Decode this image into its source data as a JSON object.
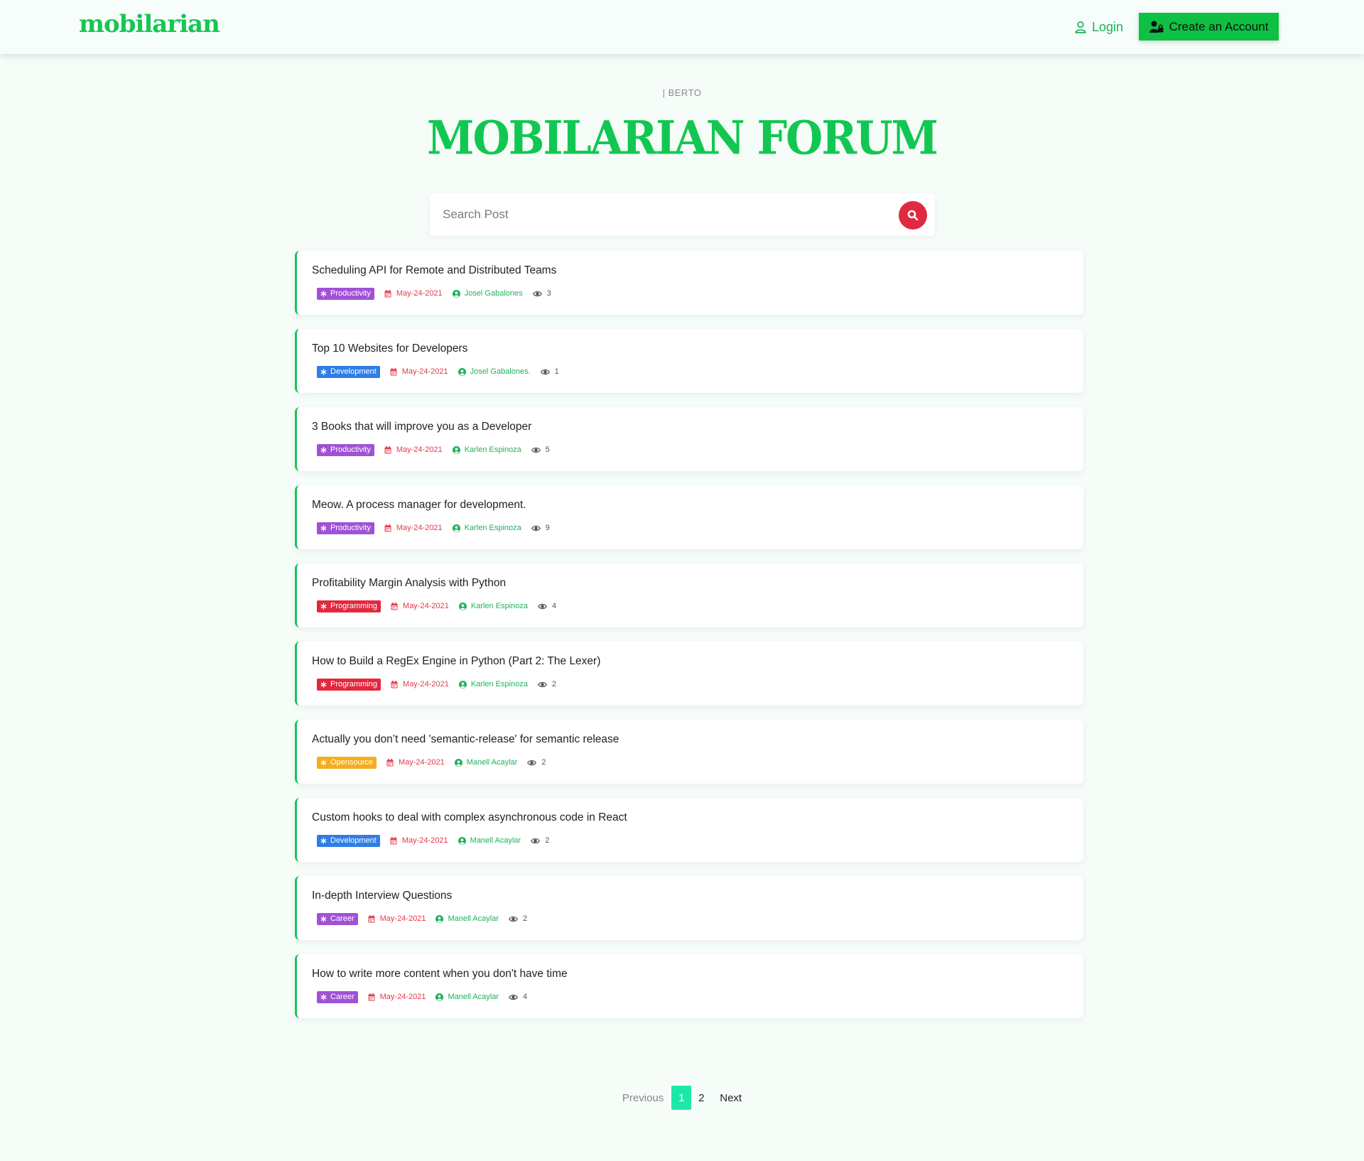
{
  "navbar": {
    "brand": "mobilarian",
    "login_label": "Login",
    "create_account_label": "Create an Account",
    "accent_color": "#17c653"
  },
  "hero": {
    "subtitle": "| BERTO",
    "title": "MOBILARIAN FORUM"
  },
  "search": {
    "placeholder": "Search Post",
    "value": "",
    "button_icon": "search-icon"
  },
  "posts": [
    {
      "title": "Scheduling API for Remote and Distributed Teams",
      "category": "Productivity",
      "category_color": "#a052d6",
      "date": "May-24-2021",
      "author": "Josel Gabalones",
      "views": "3"
    },
    {
      "title": "Top 10 Websites for Developers",
      "category": "Development",
      "category_color": "#2f7de6",
      "date": "May-24-2021",
      "author": "Josel Gabalones.",
      "views": "1"
    },
    {
      "title": "3 Books that will improve you as a Developer",
      "category": "Productivity",
      "category_color": "#a052d6",
      "date": "May-24-2021",
      "author": "Karlen Espinoza",
      "views": "5"
    },
    {
      "title": "Meow. A process manager for development.",
      "category": "Productivity",
      "category_color": "#a052d6",
      "date": "May-24-2021",
      "author": "Karlen Espinoza",
      "views": "9"
    },
    {
      "title": "Profitability Margin Analysis with Python",
      "category": "Programming",
      "category_color": "#e3283e",
      "date": "May-24-2021",
      "author": "Karlen Espinoza",
      "views": "4"
    },
    {
      "title": "How to Build a RegEx Engine in Python (Part 2: The Lexer)",
      "category": "Programming",
      "category_color": "#e3283e",
      "date": "May-24-2021",
      "author": "Karlen Espinoza",
      "views": "2"
    },
    {
      "title": "Actually you don’t need 'semantic-release' for semantic release",
      "category": "Opensource",
      "category_color": "#f5ad1d",
      "date": "May-24-2021",
      "author": "Manell Acaylar",
      "views": "2"
    },
    {
      "title": "Custom hooks to deal with complex asynchronous code in React",
      "category": "Development",
      "category_color": "#2f7de6",
      "date": "May-24-2021",
      "author": "Manell Acaylar",
      "views": "2"
    },
    {
      "title": "In-depth Interview Questions",
      "category": "Career",
      "category_color": "#a052d6",
      "date": "May-24-2021",
      "author": "Manell Acaylar",
      "views": "2"
    },
    {
      "title": "How to write more content when you don't have time",
      "category": "Career",
      "category_color": "#a052d6",
      "date": "May-24-2021",
      "author": "Manell Acaylar",
      "views": "4"
    }
  ],
  "pagination": {
    "previous_label": "Previous",
    "pages": [
      "1",
      "2"
    ],
    "current_page": "1",
    "next_label": "Next",
    "active_color": "#1ee8a8"
  }
}
